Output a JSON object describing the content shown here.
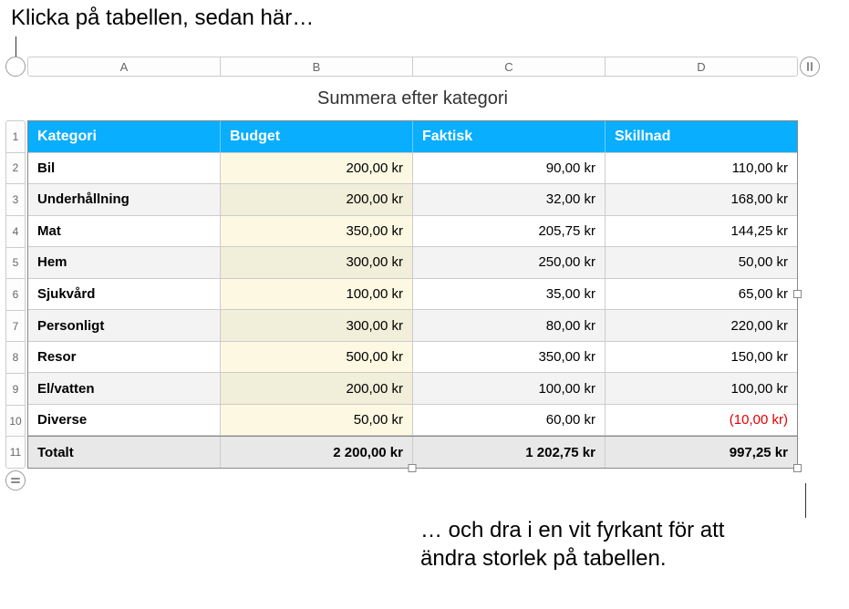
{
  "callouts": {
    "top": "Klicka på tabellen, sedan här…",
    "bottom_l1": "… och dra i en vit fyrkant för att",
    "bottom_l2": "ändra storlek på tabellen."
  },
  "table": {
    "title": "Summera efter kategori",
    "col_letters": [
      "A",
      "B",
      "C",
      "D"
    ],
    "row_numbers": [
      "1",
      "2",
      "3",
      "4",
      "5",
      "6",
      "7",
      "8",
      "9",
      "10",
      "11"
    ],
    "headers": {
      "category": "Kategori",
      "budget": "Budget",
      "actual": "Faktisk",
      "diff": "Skillnad"
    },
    "rows": [
      {
        "cat": "Bil",
        "budget": "200,00 kr",
        "actual": "90,00 kr",
        "diff": "110,00 kr",
        "neg": false
      },
      {
        "cat": "Underhållning",
        "budget": "200,00 kr",
        "actual": "32,00 kr",
        "diff": "168,00 kr",
        "neg": false
      },
      {
        "cat": "Mat",
        "budget": "350,00 kr",
        "actual": "205,75 kr",
        "diff": "144,25 kr",
        "neg": false
      },
      {
        "cat": "Hem",
        "budget": "300,00 kr",
        "actual": "250,00 kr",
        "diff": "50,00 kr",
        "neg": false
      },
      {
        "cat": "Sjukvård",
        "budget": "100,00 kr",
        "actual": "35,00 kr",
        "diff": "65,00 kr",
        "neg": false
      },
      {
        "cat": "Personligt",
        "budget": "300,00 kr",
        "actual": "80,00 kr",
        "diff": "220,00 kr",
        "neg": false
      },
      {
        "cat": "Resor",
        "budget": "500,00 kr",
        "actual": "350,00 kr",
        "diff": "150,00 kr",
        "neg": false
      },
      {
        "cat": "El/vatten",
        "budget": "200,00 kr",
        "actual": "100,00 kr",
        "diff": "100,00 kr",
        "neg": false
      },
      {
        "cat": "Diverse",
        "budget": "50,00 kr",
        "actual": "60,00 kr",
        "diff": "(10,00 kr)",
        "neg": true
      }
    ],
    "footer": {
      "label": "Totalt",
      "budget": "2 200,00 kr",
      "actual": "1 202,75 kr",
      "diff": "997,25 kr"
    }
  },
  "chart_data": {
    "type": "table",
    "title": "Summera efter kategori",
    "columns": [
      "Kategori",
      "Budget",
      "Faktisk",
      "Skillnad"
    ],
    "rows": [
      [
        "Bil",
        200.0,
        90.0,
        110.0
      ],
      [
        "Underhållning",
        200.0,
        32.0,
        168.0
      ],
      [
        "Mat",
        350.0,
        205.75,
        144.25
      ],
      [
        "Hem",
        300.0,
        250.0,
        50.0
      ],
      [
        "Sjukvård",
        100.0,
        35.0,
        65.0
      ],
      [
        "Personligt",
        300.0,
        80.0,
        220.0
      ],
      [
        "Resor",
        500.0,
        350.0,
        150.0
      ],
      [
        "El/vatten",
        200.0,
        100.0,
        100.0
      ],
      [
        "Diverse",
        50.0,
        60.0,
        -10.0
      ]
    ],
    "totals": [
      "Totalt",
      2200.0,
      1202.75,
      997.25
    ],
    "currency": "kr"
  }
}
